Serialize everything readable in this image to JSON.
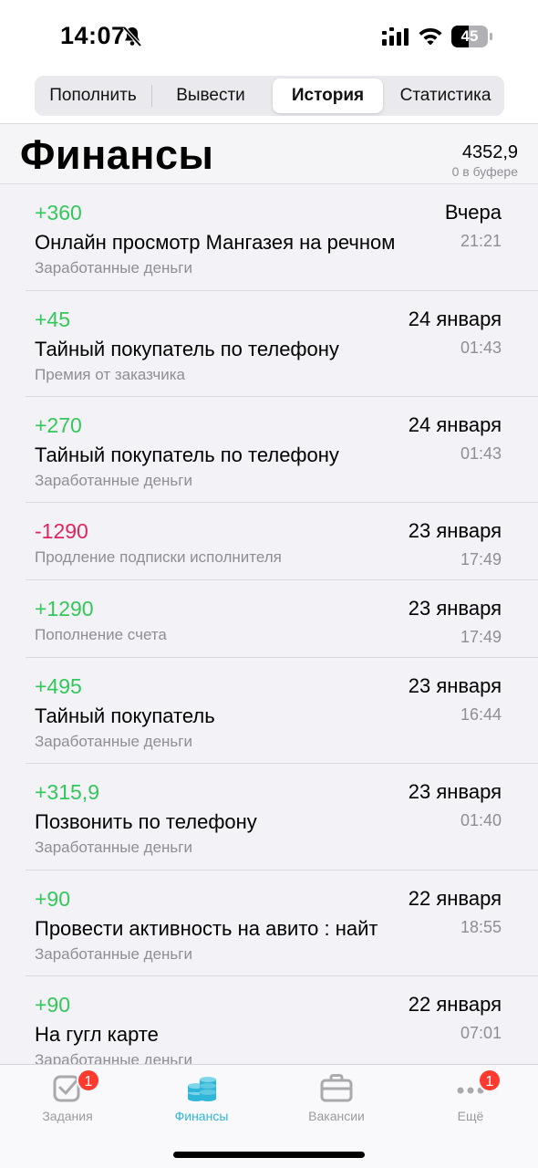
{
  "status_bar": {
    "time": "14:07",
    "battery": "45"
  },
  "segments": [
    "Пополнить",
    "Вывести",
    "История",
    "Статистика"
  ],
  "active_segment": "История",
  "header": {
    "title": "Финансы",
    "balance": "4352,9",
    "buffer": "0 в буфере"
  },
  "transactions": [
    {
      "amount": "+360",
      "date": "Вчера",
      "title": "Онлайн просмотр Мангазея на речном",
      "time": "21:21",
      "subtitle": "Заработанные деньги"
    },
    {
      "amount": "+45",
      "date": "24 января",
      "title": "Тайный покупатель по телефону",
      "time": "01:43",
      "subtitle": "Премия от заказчика"
    },
    {
      "amount": "+270",
      "date": "24 января",
      "title": "Тайный покупатель по телефону",
      "time": "01:43",
      "subtitle": "Заработанные деньги"
    },
    {
      "amount": "-1290",
      "date": "23 января",
      "title": "",
      "time": "17:49",
      "subtitle": "Продление подписки исполнителя"
    },
    {
      "amount": "+1290",
      "date": "23 января",
      "title": "",
      "time": "17:49",
      "subtitle": "Пополнение счета"
    },
    {
      "amount": "+495",
      "date": "23 января",
      "title": "Тайный покупатель",
      "time": "16:44",
      "subtitle": "Заработанные деньги"
    },
    {
      "amount": "+315,9",
      "date": "23 января",
      "title": "Позвонить по телефону",
      "time": "01:40",
      "subtitle": "Заработанные деньги"
    },
    {
      "amount": "+90",
      "date": "22 января",
      "title": "Провести активность на авито : найт",
      "time": "18:55",
      "subtitle": "Заработанные деньги"
    },
    {
      "amount": "+90",
      "date": "22 января",
      "title": "На гугл карте",
      "time": "07:01",
      "subtitle": "Заработанные деньги"
    }
  ],
  "tabbar": {
    "tasks": {
      "label": "Задания",
      "badge": "1",
      "icon": "checkbox-icon"
    },
    "finance": {
      "label": "Финансы",
      "icon": "coins-icon"
    },
    "vacancies": {
      "label": "Вакансии",
      "icon": "briefcase-icon"
    },
    "more": {
      "label": "Ещё",
      "badge": "1",
      "icon": "ellipsis-icon"
    }
  },
  "colors": {
    "positive": "#34c759",
    "negative": "#e0245e",
    "accent": "#2fb6d8",
    "badge": "#ff3b30"
  }
}
